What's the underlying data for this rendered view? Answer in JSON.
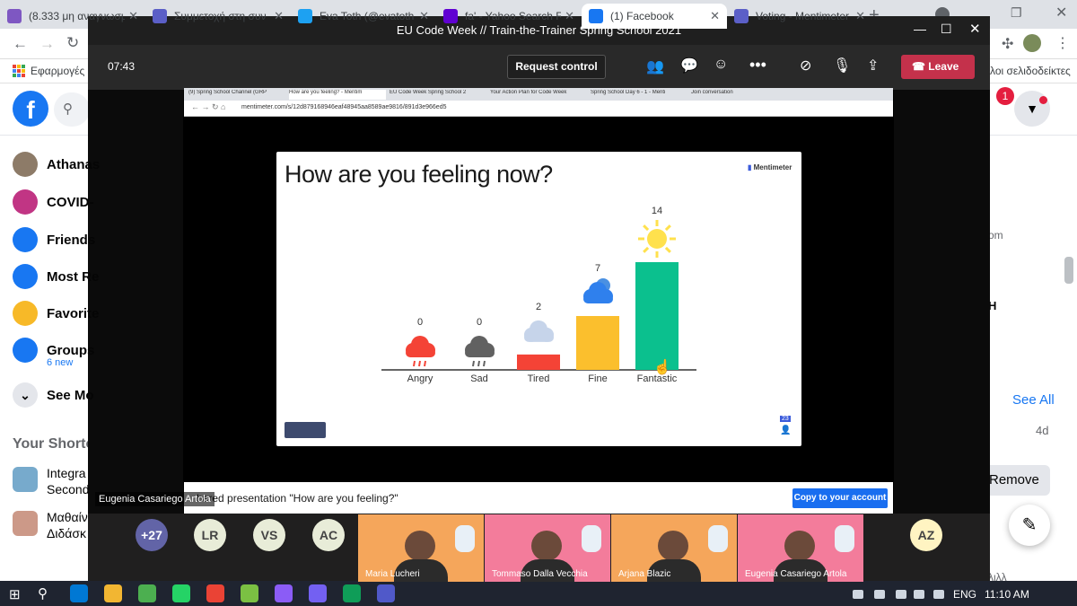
{
  "browser": {
    "tabs": [
      {
        "label": "(8.333 μη αναγνωσμέ",
        "color": "#7e57c2"
      },
      {
        "label": "Συμμετοχή στη συν",
        "color": "#5b5fc7"
      },
      {
        "label": "Eva Toth (@evatoth",
        "color": "#1da1f2"
      },
      {
        "label": "fa' - Yahoo Search R",
        "color": "#6001d2"
      },
      {
        "label": "(1) Facebook",
        "color": "#1877f2"
      },
      {
        "label": "Voting - Mentimeter",
        "color": "#5b5fc7"
      }
    ],
    "new_tab": "+",
    "bookmarks_label": "Εφαρμογές",
    "other_bookmarks": "λοι σελιδοδείκτες"
  },
  "facebook": {
    "notification_count": "1",
    "sidebar": [
      {
        "label": "Athanas",
        "icon": "avatar-icon",
        "color": "#8d7b68"
      },
      {
        "label": "COVID-",
        "icon": "heart-icon",
        "color": "#c13584"
      },
      {
        "label": "Friends",
        "icon": "friends-icon",
        "color": "#1877f2"
      },
      {
        "label": "Most Re",
        "icon": "clock-icon",
        "color": "#1877f2"
      },
      {
        "label": "Favorite",
        "icon": "star-icon",
        "color": "#f7b928"
      },
      {
        "label": "Groups",
        "icon": "groups-icon",
        "color": "#1877f2"
      },
      {
        "label": "See Mo",
        "icon": "chevron-down-icon",
        "color": "#e4e6eb"
      }
    ],
    "groups_badge": "6 new",
    "shortcuts_title": "Your Shorto",
    "shortcuts": [
      {
        "line1": "Integra",
        "line2": "Second"
      },
      {
        "line1": "Μαθαίν",
        "line2": "Διδάσκ"
      }
    ],
    "right": {
      "om": "om",
      "h": "H",
      "see_all": "See All",
      "time": "4d",
      "remove": "Remove",
      "bottom": "λιλλ"
    }
  },
  "teams": {
    "title": "EU Code Week // Train-the-Trainer Spring School 2021",
    "timer": "07:43",
    "request_control": "Request control",
    "leave": "Leave",
    "presenter_name": "Eugenia Casariego Artola",
    "shared_text": "hared presentation \"How are you feeling?\"",
    "copy_button": "Copy to your account",
    "participants_more": "+27",
    "avatars": [
      "LR",
      "VS",
      "AC",
      "AZ"
    ],
    "videos": [
      {
        "name": "Maria Lucheri"
      },
      {
        "name": "Tommaso Dalla Vecchia"
      },
      {
        "name": "Arjana Blazic"
      },
      {
        "name": "Eugenia Casariego Artola"
      }
    ]
  },
  "shared_browser": {
    "tabs": [
      "(9) Spring School Channel (GRP",
      "How are you feeling? - Mentim",
      "EU Code Week Spring School 2",
      "Your Action Plan for Code Week",
      "Spring School Day 6 - 1 - Menti",
      "Join conversation"
    ],
    "url": "mentimeter.com/s/12d879168946eaf48945aa8589ae9816/891d3e966ed5"
  },
  "mentimeter": {
    "brand": "Mentimeter",
    "question": "How are you feeling now?",
    "participant_count": "23"
  },
  "chart_data": {
    "type": "bar",
    "categories": [
      "Angry",
      "Sad",
      "Tired",
      "Fine",
      "Fantastic"
    ],
    "values": [
      0,
      0,
      2,
      7,
      14
    ],
    "colors": [
      "#f44336",
      "#616161",
      "#f44336",
      "#fbbf2d",
      "#0bc08e"
    ],
    "icons": [
      "storm-cloud-icon",
      "rain-cloud-icon",
      "cloud-icon",
      "sun-behind-cloud-icon",
      "sun-icon"
    ]
  },
  "taskbar": {
    "lang": "ENG",
    "time": "11:10 AM"
  }
}
